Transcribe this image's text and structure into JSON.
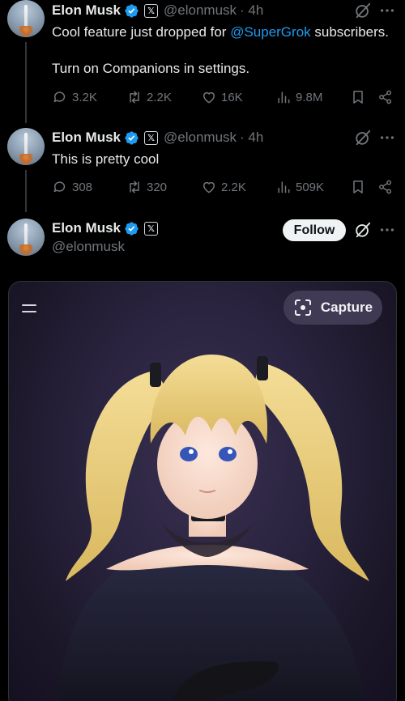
{
  "tweets": [
    {
      "author_name": "Elon Musk",
      "author_handle": "@elonmusk",
      "time": "· 4h",
      "text_line1_before": "Cool feature just dropped for ",
      "text_line1_mention": "@SuperGrok",
      "text_line1_after": " subscribers.",
      "text_line2": "Turn on Companions in settings.",
      "replies": "3.2K",
      "reposts": "2.2K",
      "likes": "16K",
      "views": "9.8M"
    },
    {
      "author_name": "Elon Musk",
      "author_handle": "@elonmusk",
      "time": "· 4h",
      "text": "This is pretty cool",
      "replies": "308",
      "reposts": "320",
      "likes": "2.2K",
      "views": "509K"
    }
  ],
  "quoted": {
    "author_name": "Elon Musk",
    "author_handle": "@elonmusk",
    "follow_label": "Follow"
  },
  "media": {
    "capture_label": "Capture"
  },
  "colors": {
    "background": "#000000",
    "text": "#e7e9ea",
    "muted": "#71767b",
    "link": "#1d9bf0",
    "verified": "#1d9bf0"
  },
  "icons": [
    "verified-badge-icon",
    "x-affiliate-icon",
    "grok-icon",
    "more-icon",
    "reply-icon",
    "repost-icon",
    "like-icon",
    "views-icon",
    "bookmark-icon",
    "share-icon",
    "hamburger-icon",
    "capture-icon"
  ]
}
